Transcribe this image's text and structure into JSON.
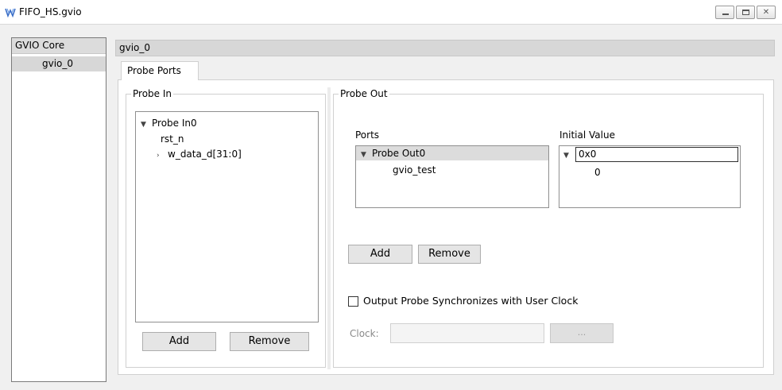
{
  "window": {
    "title": "FIFO_HS.gvio",
    "minimize_glyph": "",
    "close_glyph": "✕"
  },
  "left": {
    "header": "GVIO Core",
    "items": [
      {
        "label": "gvio_0"
      }
    ]
  },
  "right": {
    "header": "gvio_0",
    "tab": "Probe Ports"
  },
  "probe_in": {
    "title": "Probe In",
    "tree": [
      {
        "label": "Probe In0",
        "expander": "▼"
      },
      {
        "label": "rst_n"
      },
      {
        "label": "w_data_d[31:0]",
        "expander": "›"
      }
    ],
    "add_label": "Add",
    "remove_label": "Remove"
  },
  "probe_out": {
    "title": "Probe Out",
    "ports_label": "Ports",
    "initial_value_label": "Initial Value",
    "ports_tree": [
      {
        "label": "Probe Out0",
        "expander": "▼"
      },
      {
        "label": "gvio_test"
      }
    ],
    "values_tree": [
      {
        "label": "0x0",
        "expander": "▼"
      },
      {
        "label": "0"
      }
    ],
    "add_label": "Add",
    "remove_label": "Remove",
    "sync_label": "Output Probe Synchronizes with User Clock",
    "sync_checked": false,
    "clock_label": "Clock:",
    "clock_value": "",
    "browse_label": "..."
  },
  "icons": {
    "app": "gowin-logo-icon",
    "minimize": "minimize-icon",
    "maximize": "maximize-icon",
    "close": "close-icon",
    "expand": "chevron-down-icon",
    "collapsed": "chevron-right-icon"
  },
  "colors": {
    "app_icon": "#3b6fc8",
    "selection": "#dcdcdc",
    "header": "#d7d7d7"
  }
}
